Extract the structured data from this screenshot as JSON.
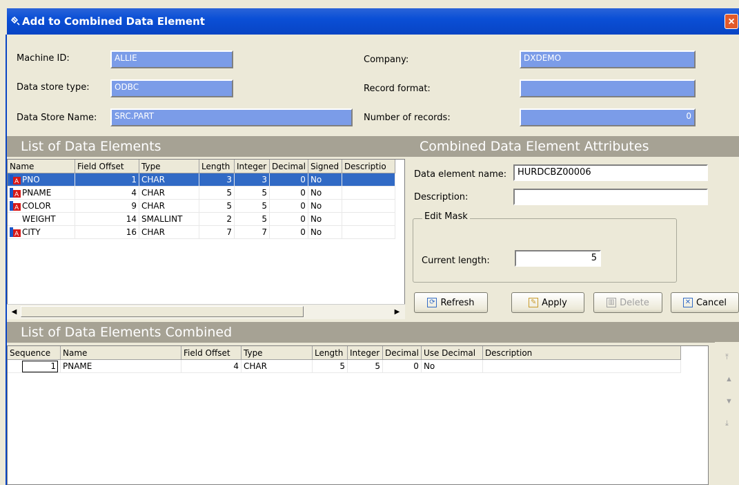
{
  "window": {
    "title": "Add to Combined Data Element",
    "close_label": "×"
  },
  "info": {
    "machine_id_label": "Machine ID:",
    "machine_id_value": "ALLIE",
    "data_store_type_label": "Data store type:",
    "data_store_type_value": "ODBC",
    "data_store_name_label": "Data Store Name:",
    "data_store_name_value": "SRC.PART",
    "company_label": "Company:",
    "company_value": "DXDEMO",
    "record_format_label": "Record format:",
    "record_format_value": "",
    "number_of_records_label": "Number of records:",
    "number_of_records_value": "0"
  },
  "elements": {
    "title": "List of Data Elements",
    "columns": [
      "Name",
      "Field Offset",
      "Type",
      "Length",
      "Integer",
      "Decimal",
      "Signed",
      "Descriptio"
    ],
    "rows": [
      {
        "name": "PNO",
        "offset": "1",
        "type": "CHAR",
        "length": "3",
        "integer": "3",
        "decimal": "0",
        "signed": "No",
        "description": "",
        "icon": true
      },
      {
        "name": "PNAME",
        "offset": "4",
        "type": "CHAR",
        "length": "5",
        "integer": "5",
        "decimal": "0",
        "signed": "No",
        "description": "",
        "icon": true
      },
      {
        "name": "COLOR",
        "offset": "9",
        "type": "CHAR",
        "length": "5",
        "integer": "5",
        "decimal": "0",
        "signed": "No",
        "description": "",
        "icon": true
      },
      {
        "name": "WEIGHT",
        "offset": "14",
        "type": "SMALLINT",
        "length": "2",
        "integer": "5",
        "decimal": "0",
        "signed": "No",
        "description": "",
        "icon": false
      },
      {
        "name": "CITY",
        "offset": "16",
        "type": "CHAR",
        "length": "7",
        "integer": "7",
        "decimal": "0",
        "signed": "No",
        "description": "",
        "icon": true
      }
    ]
  },
  "attributes": {
    "title": "Combined Data Element Attributes",
    "name_label": "Data element name:",
    "name_value": "HURDCBZ00006",
    "description_label": "Description:",
    "description_value": "",
    "edit_mask_label": "Edit Mask",
    "current_length_label": "Current length:",
    "current_length_value": "5"
  },
  "buttons": {
    "refresh": "Refresh",
    "apply": "Apply",
    "delete": "Delete",
    "cancel": "Cancel"
  },
  "combined": {
    "title": "List of Data Elements Combined",
    "columns": [
      "Sequence",
      "Name",
      "Field Offset",
      "Type",
      "Length",
      "Integer",
      "Decimal",
      "Use Decimal",
      "Description"
    ],
    "rows": [
      {
        "sequence": "1",
        "name": "PNAME",
        "offset": "4",
        "type": "CHAR",
        "length": "5",
        "integer": "5",
        "decimal": "0",
        "use_decimal": "No",
        "description": ""
      }
    ]
  },
  "colors": {
    "titlebar": "#0a4fd6",
    "selection": "#316ac5",
    "section_header": "#a6a294",
    "readonly_field": "#7b9ce8"
  }
}
